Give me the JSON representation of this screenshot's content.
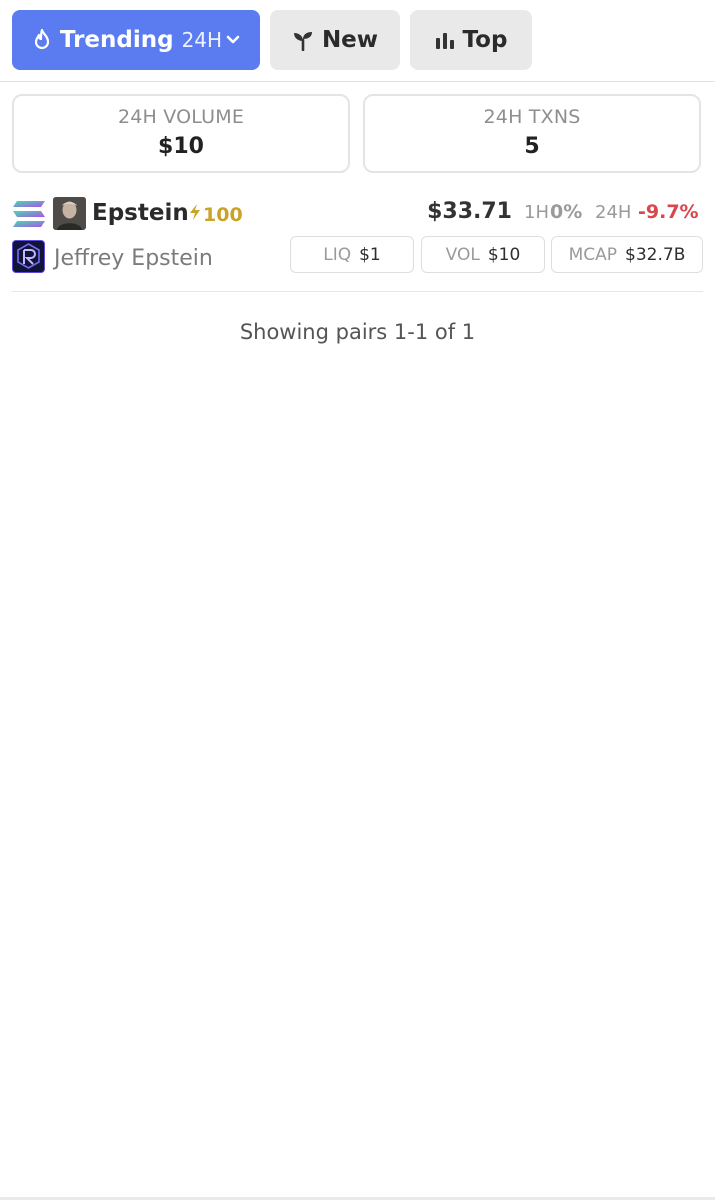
{
  "tabs": {
    "trending": {
      "label": "Trending",
      "timeframe": "24H"
    },
    "new": {
      "label": "New"
    },
    "top": {
      "label": "Top"
    }
  },
  "stats": {
    "volume": {
      "label": "24H VOLUME",
      "value": "$10"
    },
    "txns": {
      "label": "24H TXNS",
      "value": "5"
    }
  },
  "pairs": [
    {
      "symbol": "Epstein",
      "boost": "100",
      "name": "Jeffrey Epstein",
      "price": "$33.71",
      "change_1h_label": "1H",
      "change_1h": "0%",
      "change_24h_label": "24H",
      "change_24h": "-9.7%",
      "liq_label": "LIQ",
      "liq": "$1",
      "vol_label": "VOL",
      "vol": "$10",
      "mcap_label": "MCAP",
      "mcap": "$32.7B",
      "chain_icon": "solana-icon",
      "dex_icon": "raydium-icon"
    }
  ],
  "footer": {
    "showing": "Showing pairs 1-1 of 1"
  },
  "colors": {
    "accent": "#5b7cf0",
    "negative": "#d9464b",
    "boost": "#c9a227",
    "button_bg": "#e9e9e9"
  }
}
